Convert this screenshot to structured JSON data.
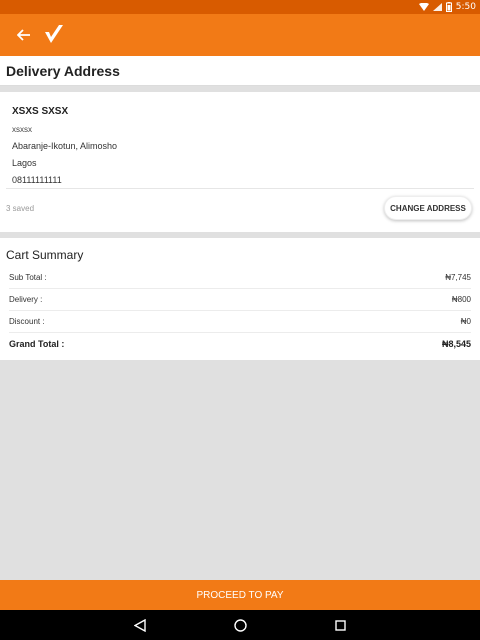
{
  "status_bar": {
    "time": "5:50"
  },
  "colors": {
    "accent": "#f27a16",
    "status_bar": "#d85b00"
  },
  "header": {
    "back_icon": "arrow-left-icon",
    "logo_icon": "brand-check-logo"
  },
  "delivery": {
    "title": "Delivery Address",
    "name": "XSXS SXSX",
    "line2": "xsxsx",
    "area": "Abaranje-Ikotun, Alimosho",
    "city": "Lagos",
    "phone": "08111111111",
    "saved_count": "3 saved",
    "change_button": "CHANGE ADDRESS"
  },
  "cart": {
    "title": "Cart Summary",
    "rows": [
      {
        "label": "Sub Total :",
        "value": "₦7,745"
      },
      {
        "label": "Delivery :",
        "value": "₦800"
      },
      {
        "label": "Discount :",
        "value": "₦0"
      },
      {
        "label": "Grand Total :",
        "value": "₦8,545"
      }
    ]
  },
  "proceed_button": "PROCEED TO PAY",
  "nav": {
    "back": "triangle-back-icon",
    "home": "circle-home-icon",
    "recents": "square-recents-icon"
  }
}
